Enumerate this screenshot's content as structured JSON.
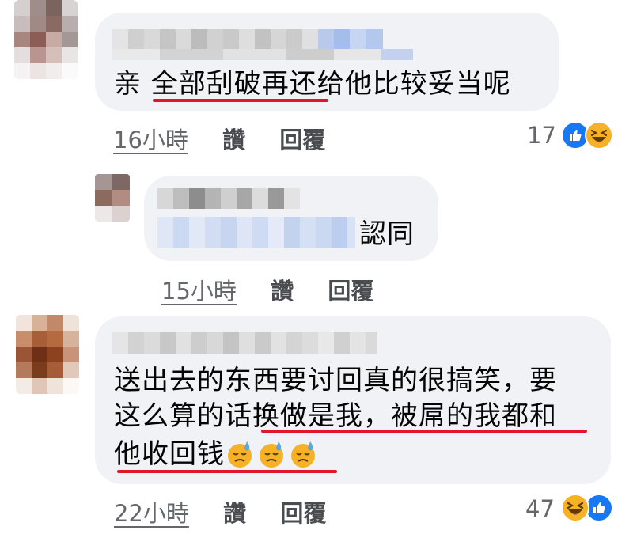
{
  "comments": [
    {
      "text": "亲 全部刮破再还给他比较妥当呢",
      "underlined": "全部刮破再还",
      "time": "16小時",
      "like_label": "讚",
      "reply_label": "回覆",
      "reaction_count": "17",
      "reactions": [
        "like-icon",
        "haha-icon"
      ]
    },
    {
      "text": "認同",
      "time": "15小時",
      "like_label": "讚",
      "reply_label": "回覆"
    },
    {
      "line1": "送出去的东西要讨回真的很搞笑，要",
      "line2": "这么算的话换做是我，被屌的我都和",
      "line3": "他收回钱",
      "underlined": "换做是我，被屌的我都和他收回钱",
      "emojis": [
        "sweat-face-icon",
        "sweat-face-icon",
        "sweat-face-icon"
      ],
      "time": "22小時",
      "like_label": "讚",
      "reply_label": "回覆",
      "reaction_count": "47",
      "reactions": [
        "haha-icon",
        "like-icon"
      ]
    }
  ],
  "colors": {
    "bubble": "#f0f2f5",
    "underline": "#e0162b",
    "meta": "#65676b",
    "like": "#1877f2",
    "haha": "#f7b125"
  }
}
